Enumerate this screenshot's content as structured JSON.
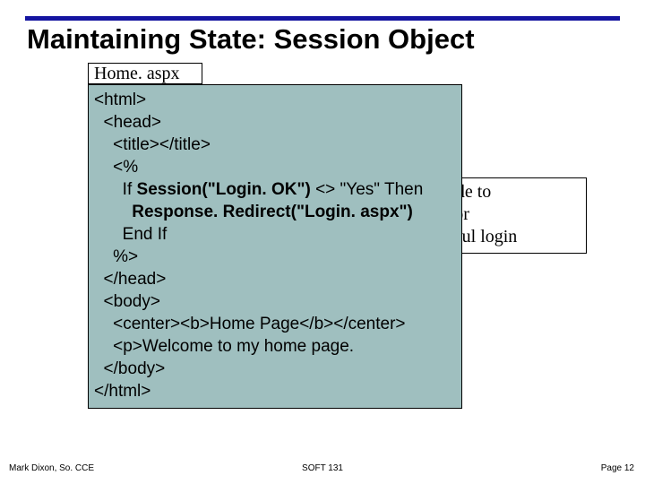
{
  "title": "Maintaining State: Session Object",
  "file_tab": "Home. aspx",
  "code": {
    "l1": "<html>",
    "l2": "  <head>",
    "l3": "    <title></title>",
    "l4": "    <%",
    "l5a": "      If ",
    "l5b": "Session(\"Login. OK\")",
    "l5c": " <> \"Yes\" Then",
    "l6a": "        ",
    "l6b": "Response. Redirect(\"Login. aspx\")",
    "l7": "      End If",
    "l8": "    %>",
    "l9": "  </head>",
    "l10": "  <body>",
    "l11": "    <center><b>Home Page</b></center>",
    "l12": "    <p>Welcome to my home page.",
    "l13": "  </body>",
    "l14": "</html>"
  },
  "note": {
    "l1": "ASP code to",
    "l2": "check for",
    "l3": "successful login"
  },
  "footer": {
    "left": "Mark Dixon, So. CCE",
    "center": "SOFT 131",
    "right": "Page 12"
  }
}
